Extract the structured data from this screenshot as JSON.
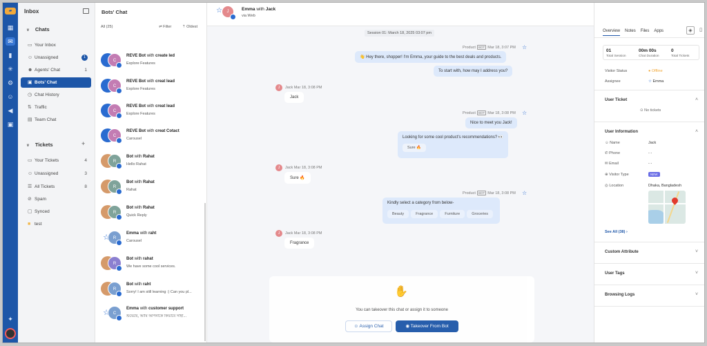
{
  "sidebar": {
    "title": "Inbox",
    "chats_section": "Chats",
    "chat_items": [
      {
        "label": "Your Inbox",
        "count": ""
      },
      {
        "label": "Unassigned",
        "count": "1"
      },
      {
        "label": "Agents' Chat",
        "count": "1"
      },
      {
        "label": "Bots' Chat",
        "count": ""
      },
      {
        "label": "Chat History",
        "count": ""
      },
      {
        "label": "Traffic",
        "count": ""
      },
      {
        "label": "Team Chat",
        "count": ""
      }
    ],
    "tickets_section": "Tickets",
    "ticket_items": [
      {
        "label": "Your Tickets",
        "count": "4"
      },
      {
        "label": "Unassigned",
        "count": "3"
      },
      {
        "label": "All Tickets",
        "count": "8"
      },
      {
        "label": "Spam",
        "count": ""
      },
      {
        "label": "Synced",
        "count": ""
      },
      {
        "label": "test",
        "count": ""
      }
    ]
  },
  "list": {
    "title": "Bots' Chat",
    "all_label": "All (25)",
    "filter_label": "Filter",
    "oldest_label": "Oldest",
    "conversations": [
      {
        "a": "REVE Bot",
        "w": "with",
        "b": "create led",
        "sub": "Explore Features",
        "c1": "#2a6bd0",
        "c2": "#c37cb3",
        "i1": "",
        "i2": "C"
      },
      {
        "a": "REVE Bot",
        "w": "with",
        "b": "creat lead",
        "sub": "Explore Features",
        "c1": "#2a6bd0",
        "c2": "#c37cb3",
        "i1": "",
        "i2": "C"
      },
      {
        "a": "REVE Bot",
        "w": "with",
        "b": "creat lead",
        "sub": "Explore Features",
        "c1": "#2a6bd0",
        "c2": "#c37cb3",
        "i1": "",
        "i2": "C"
      },
      {
        "a": "REVE Bot",
        "w": "with",
        "b": "creat Cotact",
        "sub": "Carousel",
        "c1": "#2a6bd0",
        "c2": "#c37cb3",
        "i1": "",
        "i2": "C"
      },
      {
        "a": "Bot",
        "w": "with",
        "b": "Rahat",
        "sub": "Hello Rahat",
        "c1": "#d59a6a",
        "c2": "#7fa39a",
        "i1": "",
        "i2": "R"
      },
      {
        "a": "Bot",
        "w": "with",
        "b": "Rahat",
        "sub": "Rahat",
        "c1": "#d59a6a",
        "c2": "#7fa39a",
        "i1": "",
        "i2": "R"
      },
      {
        "a": "Bot",
        "w": "with",
        "b": "Rahat",
        "sub": "Quick Reply",
        "c1": "#d59a6a",
        "c2": "#7fa39a",
        "i1": "",
        "i2": "R"
      },
      {
        "a": "Emma",
        "w": "with",
        "b": "raht",
        "sub": "Carousel",
        "c1": "#ffffff",
        "c2": "#7a9fd0",
        "i1": "",
        "i2": "R"
      },
      {
        "a": "Bot",
        "w": "with",
        "b": "rahat",
        "sub": "We have some cool services.",
        "c1": "#d59a6a",
        "c2": "#8b7fd0",
        "i1": "",
        "i2": "R"
      },
      {
        "a": "Bot",
        "w": "with",
        "b": "raht",
        "sub": "Sorry! I am still learning :) Can you pl...",
        "c1": "#d59a6a",
        "c2": "#7a9fd0",
        "i1": "",
        "i2": "R"
      },
      {
        "a": "Emma",
        "w": "with",
        "b": "customer support",
        "sub": "শুভেছে, আমি আপনাকে কিভাবে সাহা...",
        "c1": "#ffffff",
        "c2": "#7a9fd0",
        "i1": "",
        "i2": "C"
      }
    ]
  },
  "chat": {
    "header_a": "Emma",
    "header_w": "with",
    "header_b": "Jack",
    "header_sub": "via Web",
    "header_initial": "J",
    "session": "Session 01: March 18, 2025 03:07 pm",
    "bot_meta_1": "Product",
    "bot_tag": "BOT",
    "bot_time_1": "Mar 18, 3:07 PM",
    "msg_1": "👋 Hey there, shopper! I'm Emma, your guide to the best deals and products.",
    "msg_2": "To start with, how may I address you?",
    "user_meta_1": "Jack Mar 18, 3:08 PM",
    "user_msg_1": "Jack",
    "bot_time_2": "Mar 18, 3:08 PM",
    "msg_3": "Nice to meet you Jack!",
    "msg_4": "Looking for some cool product's recommendations? 👀",
    "chip_sure": "Sure 🔥",
    "user_meta_2": "Jack Mar 18, 3:08 PM",
    "user_msg_2": "Sure 🔥",
    "bot_time_3": "Mar 18, 3:08 PM",
    "msg_5": "Kindly select a category from below-",
    "categories": [
      "Beauty",
      "Fragrance",
      "Furniture",
      "Groceries"
    ],
    "user_meta_3": "Jack Mar 18, 3:08 PM",
    "user_msg_3": "Fragrance",
    "takeover_text": "You can takeover this chat or assign it to someone",
    "assign_label": "Assign Chat",
    "takeover_label": "Takeover From Bot"
  },
  "details": {
    "tabs": [
      "Overview",
      "Notes",
      "Files",
      "Apps"
    ],
    "stats": [
      {
        "value": "01",
        "label": "Total Session"
      },
      {
        "value": "00m 00s",
        "label": "Chat Duration"
      },
      {
        "value": "0",
        "label": "Total Tickets"
      }
    ],
    "visitor_status_label": "Visitor Status",
    "visitor_status_value": "Offline",
    "assignee_label": "Assignee",
    "assignee_value": "Emma",
    "user_ticket_title": "User Ticket",
    "no_tickets": "No tickets",
    "user_info_title": "User Information",
    "info": [
      {
        "label": "Name",
        "value": "Jack"
      },
      {
        "label": "Phone",
        "value": "- -"
      },
      {
        "label": "Email",
        "value": "- -"
      },
      {
        "label": "Visitor Type",
        "value": ""
      },
      {
        "label": "Location",
        "value": "Dhaka, Bangladesh"
      }
    ],
    "new_badge": "NEW",
    "see_all": "See All (38) ›",
    "custom_attribute": "Custom Attribute",
    "user_tags": "User Tags",
    "browsing_logs": "Browsing Logs"
  },
  "colors": {
    "brand": "#1d56a8",
    "offline": "#f2a93b"
  }
}
